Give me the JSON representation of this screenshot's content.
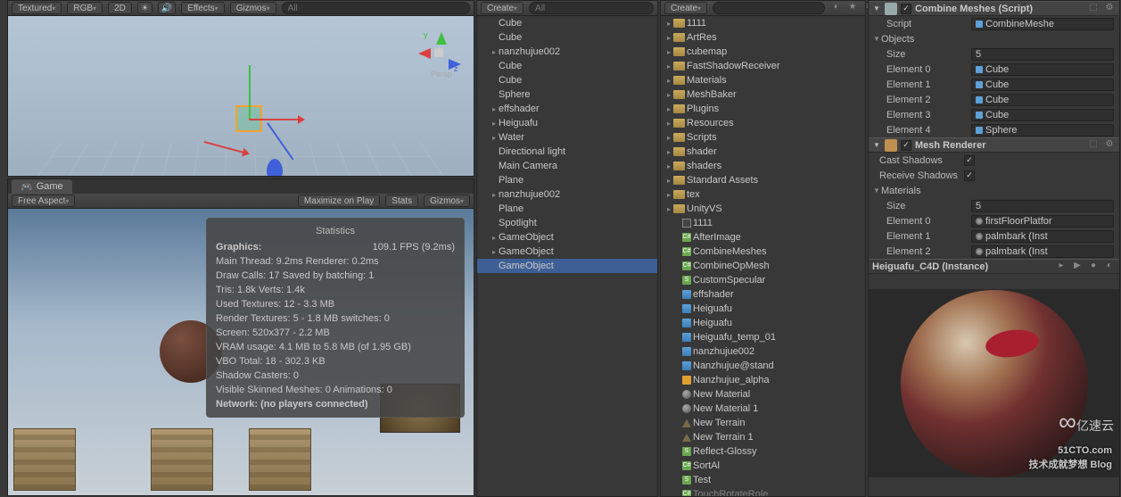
{
  "scene": {
    "toolbar": {
      "shading": "Textured",
      "render": "RGB",
      "mode": "2D",
      "effects": "Effects",
      "gizmos": "Gizmos",
      "search": "All"
    }
  },
  "game": {
    "tab": "Game",
    "aspect": "Free Aspect",
    "maximize": "Maximize on Play",
    "stats_btn": "Stats",
    "gizmos_btn": "Gizmos",
    "stats": {
      "title": "Statistics",
      "graphics": "Graphics:",
      "fps": "109.1 FPS (9.2ms)",
      "main_thread": "Main Thread: 9.2ms  Renderer: 0.2ms",
      "draw_calls": "Draw Calls: 17    Saved by batching: 1",
      "tris": "Tris: 1.8k    Verts: 1.4k",
      "used_tex": "Used Textures: 12 - 3.3 MB",
      "render_tex": "Render Textures: 5 - 1.8 MB  switches: 0",
      "screen": "Screen: 520x377 - 2.2 MB",
      "vram": "VRAM usage: 4.1 MB to 5.8 MB (of 1.95 GB)",
      "vbo": "VBO Total: 18 - 302.3 KB",
      "shadow": "Shadow Casters: 0",
      "skinned": "Visible Skinned Meshes: 0     Animations: 0",
      "network": "Network: (no players connected)"
    }
  },
  "hierarchy": {
    "create": "Create",
    "search": "All",
    "items": [
      {
        "l": "Cube",
        "t": "item"
      },
      {
        "l": "Cube",
        "t": "item"
      },
      {
        "l": "nanzhujue002",
        "t": "parent",
        "dim": true
      },
      {
        "l": "Cube",
        "t": "item"
      },
      {
        "l": "Cube",
        "t": "item"
      },
      {
        "l": "Sphere",
        "t": "item"
      },
      {
        "l": "effshader",
        "t": "parent",
        "dim": true
      },
      {
        "l": "Heiguafu",
        "t": "parent",
        "dim": true
      },
      {
        "l": "Water",
        "t": "parent",
        "dim": true
      },
      {
        "l": "Directional light",
        "t": "item"
      },
      {
        "l": "Main Camera",
        "t": "item"
      },
      {
        "l": "Plane",
        "t": "item"
      },
      {
        "l": "nanzhujue002",
        "t": "parent",
        "dim": true
      },
      {
        "l": "Plane",
        "t": "item"
      },
      {
        "l": "Spotlight",
        "t": "item"
      },
      {
        "l": "GameObject",
        "t": "parent",
        "dim": true
      },
      {
        "l": "GameObject",
        "t": "parent",
        "dim": true
      },
      {
        "l": "GameObject",
        "t": "item",
        "sel": true
      }
    ]
  },
  "project": {
    "create": "Create",
    "search": "",
    "items": [
      {
        "l": "1111",
        "t": "folder"
      },
      {
        "l": "ArtRes",
        "t": "folder"
      },
      {
        "l": "cubemap",
        "t": "folder"
      },
      {
        "l": "FastShadowReceiver",
        "t": "folder"
      },
      {
        "l": "Materials",
        "t": "folder"
      },
      {
        "l": "MeshBaker",
        "t": "folder"
      },
      {
        "l": "Plugins",
        "t": "folder"
      },
      {
        "l": "Resources",
        "t": "folder"
      },
      {
        "l": "Scripts",
        "t": "folder"
      },
      {
        "l": "shader",
        "t": "folder"
      },
      {
        "l": "shaders",
        "t": "folder"
      },
      {
        "l": "Standard Assets",
        "t": "folder"
      },
      {
        "l": "tex",
        "t": "folder"
      },
      {
        "l": "UnityVS",
        "t": "folder"
      },
      {
        "l": "1111",
        "t": "scene"
      },
      {
        "l": "AfterImage",
        "t": "cs"
      },
      {
        "l": "CombineMeshes",
        "t": "cs"
      },
      {
        "l": "CombineOpMesh",
        "t": "cs"
      },
      {
        "l": "CustomSpecular",
        "t": "shader"
      },
      {
        "l": "effshader",
        "t": "prefab"
      },
      {
        "l": "Heiguafu",
        "t": "prefab"
      },
      {
        "l": "Heiguafu",
        "t": "prefab"
      },
      {
        "l": "Heiguafu_temp_01",
        "t": "prefab"
      },
      {
        "l": "nanzhujue002",
        "t": "prefab"
      },
      {
        "l": "Nanzhujue@stand",
        "t": "prefab"
      },
      {
        "l": "Nanzhujue_alpha",
        "t": "tex"
      },
      {
        "l": "New Material",
        "t": "mat"
      },
      {
        "l": "New Material 1",
        "t": "mat"
      },
      {
        "l": "New Terrain",
        "t": "terr"
      },
      {
        "l": "New Terrain 1",
        "t": "terr"
      },
      {
        "l": "Reflect-Glossy",
        "t": "shader"
      },
      {
        "l": "SortAl",
        "t": "cs"
      },
      {
        "l": "Test",
        "t": "shader"
      },
      {
        "l": "TouchRotateRole",
        "t": "cs",
        "cut": true
      }
    ]
  },
  "inspector": {
    "combine": {
      "title": "Combine Meshes (Script)",
      "script_lbl": "Script",
      "script_val": "CombineMeshe",
      "objects_lbl": "Objects",
      "size_lbl": "Size",
      "size_val": "5",
      "elements": [
        {
          "lbl": "Element 0",
          "val": "Cube"
        },
        {
          "lbl": "Element 1",
          "val": "Cube"
        },
        {
          "lbl": "Element 2",
          "val": "Cube"
        },
        {
          "lbl": "Element 3",
          "val": "Cube"
        },
        {
          "lbl": "Element 4",
          "val": "Sphere"
        }
      ]
    },
    "renderer": {
      "title": "Mesh Renderer",
      "cast_lbl": "Cast Shadows",
      "recv_lbl": "Receive Shadows",
      "mats_lbl": "Materials",
      "size_lbl": "Size",
      "size_val": "5",
      "elements": [
        {
          "lbl": "Element 0",
          "val": "firstFloorPlatfor"
        },
        {
          "lbl": "Element 1",
          "val": "palmbark (Inst"
        },
        {
          "lbl": "Element 2",
          "val": "palmbark (Inst"
        }
      ]
    },
    "material": {
      "title": "Heiguafu_C4D (Instance)"
    }
  },
  "watermark": {
    "main": "51CTO.com",
    "sub": "技术成就梦想    Blog",
    "side": "亿速云"
  }
}
